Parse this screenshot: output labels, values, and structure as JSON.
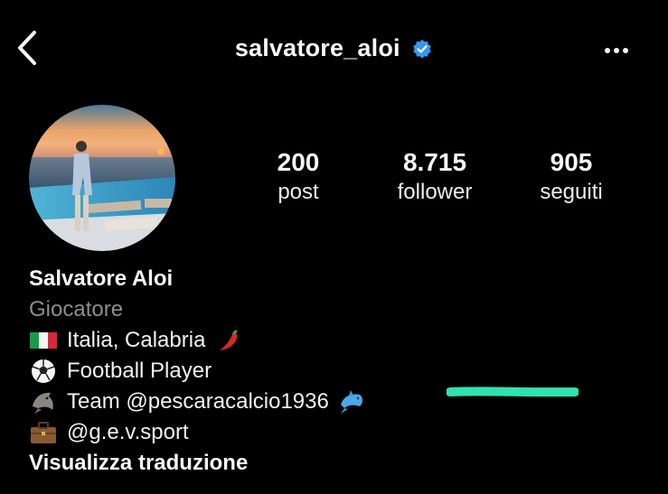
{
  "header": {
    "username": "salvatore_aloi",
    "verified_icon": "verified-badge-icon",
    "back_icon": "chevron-left-icon",
    "more_icon": "more-horizontal-icon"
  },
  "profile": {
    "avatar_icon": "profile-photo"
  },
  "stats": {
    "posts": {
      "value": "200",
      "label": "post"
    },
    "followers": {
      "value": "8.715",
      "label": "follower"
    },
    "following": {
      "value": "905",
      "label": "seguiti"
    }
  },
  "bio": {
    "name": "Salvatore Aloi",
    "category": "Giocatore",
    "lines": [
      {
        "emoji": "italy-flag-icon",
        "text": "Italia, Calabria",
        "trailing_emoji": "chili-pepper-icon"
      },
      {
        "emoji": "soccer-ball-icon",
        "text": "Football Player"
      },
      {
        "emoji": "dolphin-icon",
        "text": "Team @pescaracalcio1936",
        "trailing_emoji": "dolphin-icon"
      },
      {
        "emoji": "briefcase-icon",
        "text": "@g.e.v.sport"
      }
    ],
    "translate_label": "Visualizza traduzione"
  },
  "colors": {
    "background": "#000000",
    "text": "#f5f5f5",
    "muted": "#8e8e8e",
    "verified": "#3897f0",
    "marker": "#2fe3b0"
  }
}
